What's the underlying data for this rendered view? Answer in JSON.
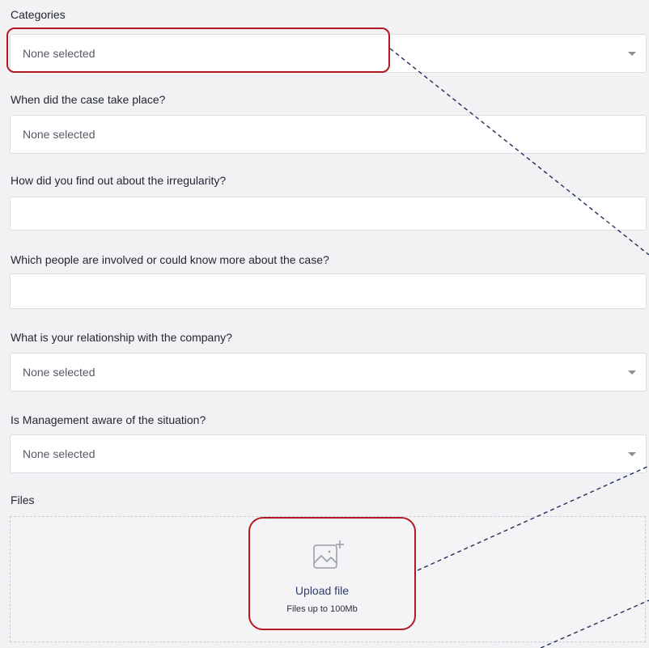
{
  "form": {
    "categories": {
      "label": "Categories",
      "value": "None selected"
    },
    "date": {
      "label": "When did the case take place?",
      "value": "None selected"
    },
    "discovery": {
      "label": "How did you find out about the irregularity?",
      "value": ""
    },
    "people": {
      "label": "Which people are involved or could know more about the case?",
      "value": ""
    },
    "relationship": {
      "label": "What is your relationship with the company?",
      "value": "None selected"
    },
    "management": {
      "label": "Is Management aware of the situation?",
      "value": "None selected"
    },
    "files": {
      "label": "Files",
      "upload_label": "Upload file",
      "upload_hint": "Files up to 100Mb"
    }
  },
  "icons": {
    "dropdown": "chevron-down-icon",
    "upload": "image-add-icon"
  },
  "colors": {
    "highlight": "#b11a22",
    "callout_line": "#1f2e5a",
    "upload_text": "#2e3f6e",
    "background": "#f2f2f4",
    "field_border": "#dcdde3"
  }
}
